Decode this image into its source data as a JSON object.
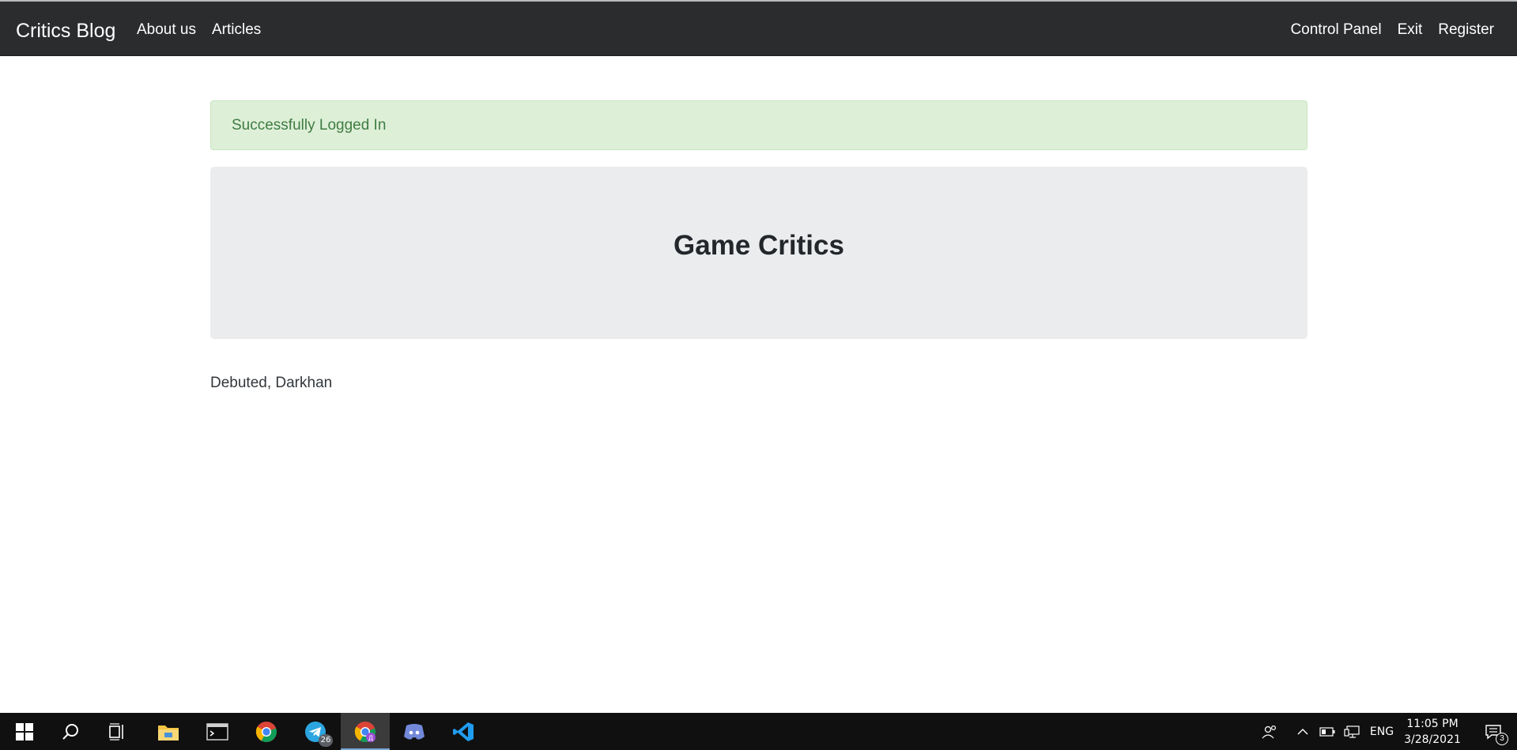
{
  "navbar": {
    "brand": "Critics Blog",
    "left_links": [
      "About us",
      "Articles"
    ],
    "right_links": [
      "Control Panel",
      "Exit",
      "Register"
    ],
    "background": "#2b2c2e"
  },
  "alert": {
    "message": "Successfully Logged In",
    "background": "#deefd8",
    "text_color": "#3f7c42"
  },
  "jumbotron": {
    "title": "Game Critics"
  },
  "footer": {
    "text": "Debuted, Darkhan"
  },
  "taskbar": {
    "apps": [
      {
        "icon": "windows-start-icon"
      },
      {
        "icon": "search-icon"
      },
      {
        "icon": "task-view-icon"
      },
      {
        "icon": "file-explorer-icon"
      },
      {
        "icon": "terminal-icon"
      },
      {
        "icon": "chrome-icon"
      },
      {
        "icon": "telegram-icon",
        "badge": "26"
      },
      {
        "icon": "chrome-profile-icon",
        "active": true
      },
      {
        "icon": "discord-icon"
      },
      {
        "icon": "vscode-icon"
      }
    ],
    "tray": {
      "language": "ENG",
      "time": "11:05 PM",
      "date": "3/28/2021",
      "notifications": "3"
    }
  }
}
